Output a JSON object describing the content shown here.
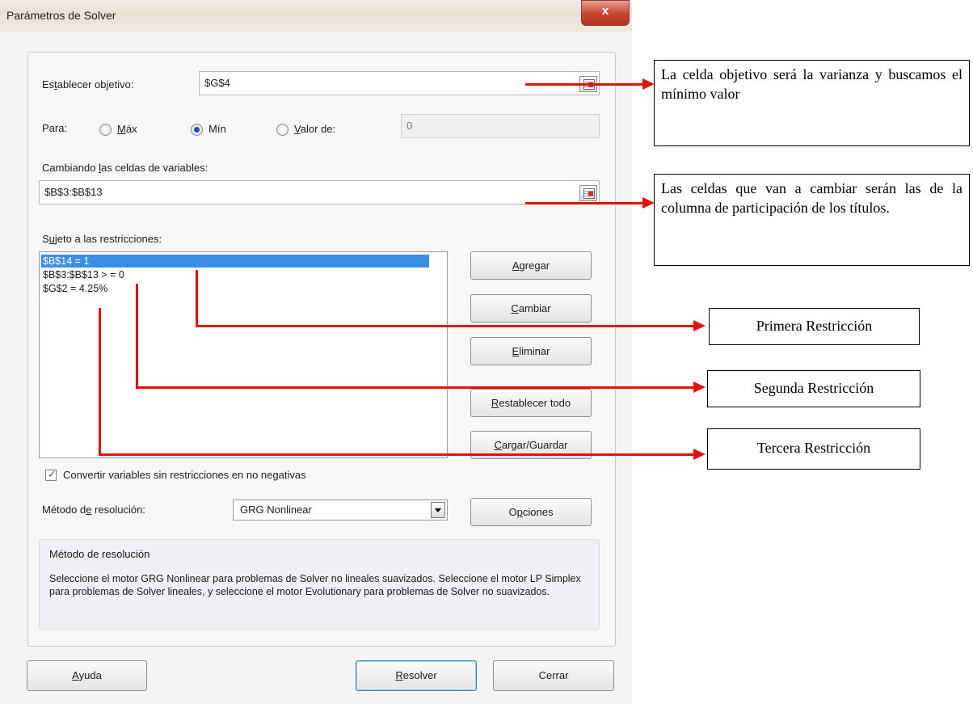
{
  "window": {
    "title": "Parámetros de Solver",
    "close_glyph": "x"
  },
  "objective": {
    "label": "Establecer objetivo:",
    "label_pre": "Es",
    "label_key": "t",
    "label_post": "ablecer objetivo:",
    "value": "$G$4"
  },
  "to": {
    "label": "Para:",
    "options": [
      {
        "pre": "",
        "key": "M",
        "post": "áx",
        "selected": false
      },
      {
        "pre": "Mín",
        "key": "",
        "post": "",
        "selected": true
      },
      {
        "pre": "",
        "key": "V",
        "post": "alor de:",
        "selected": false
      }
    ],
    "value_of": "0"
  },
  "variables": {
    "label_pre": "Cambiando ",
    "label_key": "l",
    "label_post": "as celdas de variables:",
    "value": "$B$3:$B$13"
  },
  "constraints": {
    "label_pre": "S",
    "label_key": "u",
    "label_post": "jeto a las restricciones:",
    "items": [
      "$B$14 = 1",
      "$B$3:$B$13 > = 0",
      "$G$2 = 4.25%"
    ]
  },
  "side_buttons": [
    {
      "key": "A",
      "rest": "gregar"
    },
    {
      "key": "C",
      "rest": "ambiar"
    },
    {
      "key": "E",
      "rest": "liminar"
    },
    {
      "key": "R",
      "rest": "establecer todo"
    },
    {
      "key": "C",
      "rest": "argar/Guardar"
    }
  ],
  "nonneg": {
    "label": "Convertir variables sin restricciones en no negativas",
    "checked": true
  },
  "method": {
    "label_pre": "Método d",
    "label_key": "e",
    "label_post": " resolución:",
    "value": "GRG Nonlinear"
  },
  "options_button": {
    "pre": "O",
    "key": "p",
    "post": "ciones"
  },
  "description": {
    "title": "Método de resolución",
    "text": "Seleccione el motor GRG Nonlinear para problemas de Solver no lineales suavizados. Seleccione el motor LP Simplex para problemas de Solver lineales, y seleccione el motor Evolutionary para problemas de Solver no suavizados."
  },
  "footer": {
    "help": {
      "key": "A",
      "rest": "yuda"
    },
    "solve": {
      "key": "R",
      "rest": "esolver"
    },
    "close": "Cerrar"
  },
  "annotations": {
    "objective_note": "La celda objetivo será la varianza y buscamos el mínimo valor",
    "variables_note": "Las celdas que van a cambiar serán las de la columna de participación de los títulos.",
    "first": "Primera Restricción",
    "second": "Segunda Restricción",
    "third": "Tercera Restricción"
  },
  "colors": {
    "annotation_red": "#e3120b",
    "selection_blue": "#3b8ee6"
  }
}
